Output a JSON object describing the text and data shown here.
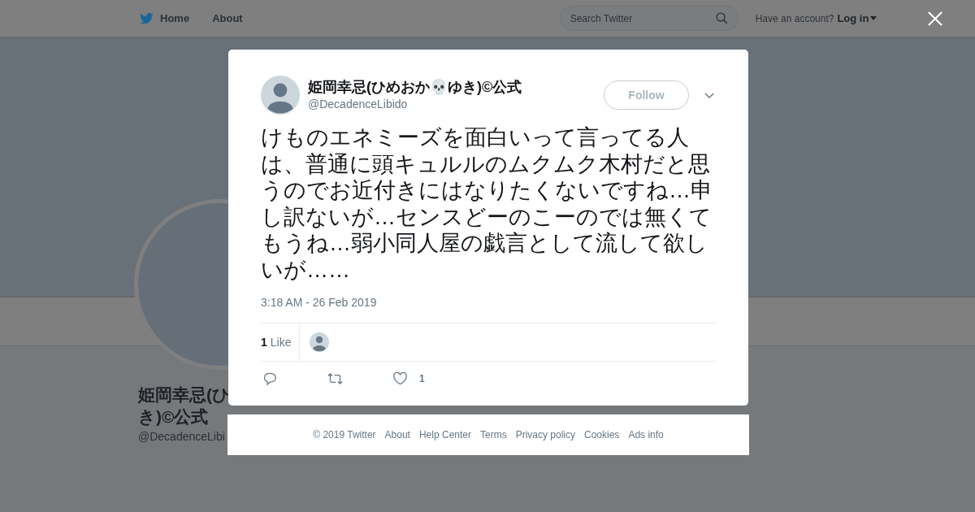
{
  "nav": {
    "items": [
      {
        "label": "Home"
      },
      {
        "label": "About"
      }
    ],
    "search": {
      "placeholder": "Search Twitter"
    },
    "account_prompt": "Have an account?",
    "login": "Log in"
  },
  "profile": {
    "name_lines": [
      "姫岡幸忌(ひ",
      "き)©公式"
    ],
    "handle": "@DecadenceLibi"
  },
  "tweet": {
    "name": "姫岡幸忌(ひめおか💀ゆき)©公式",
    "handle": "@DecadenceLibido",
    "follow": "Follow",
    "text": "けものエネミーズを面白いって言ってる人は、普通に頭キュルルのムクムク木村だと思うのでお近付きにはなりたくないですね…申し訳ないが…センスどーのこーのでは無くてもうね…弱小同人屋の戯言として流して欲しいが……",
    "time": "3:18 AM - 26 Feb 2019",
    "likes_count": "1",
    "likes_label": "Like",
    "like_action_count": "1"
  },
  "footer": [
    "© 2019 Twitter",
    "About",
    "Help Center",
    "Terms",
    "Privacy policy",
    "Cookies",
    "Ads info"
  ]
}
